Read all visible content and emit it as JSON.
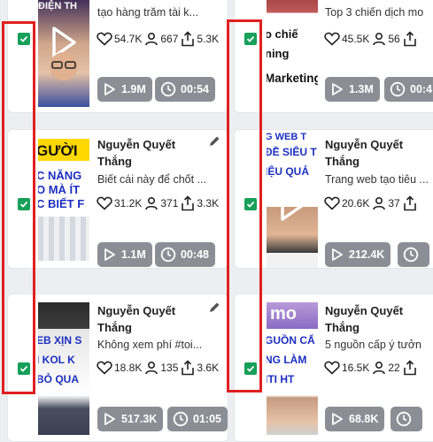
{
  "cards": [
    {
      "author_line1": "",
      "author_line2": "",
      "desc": "tạo hàng trăm tài k...",
      "likes": "54.7K",
      "users": "667",
      "shares": "5.3K",
      "views": "1.9M",
      "duration": "00:54",
      "thumb_text": [
        "ĐIỆN TH"
      ]
    },
    {
      "author_line1": "",
      "author_line2": "",
      "desc": "Top 3 chiến dịch mo",
      "likes": "45.5K",
      "users": "56",
      "shares": "",
      "views": "1.3M",
      "duration": "00:4",
      "thumb_text": [
        "o chiế",
        "ning",
        "Marketing"
      ]
    },
    {
      "author_line1": "Nguyễn Quyết",
      "author_line2": "Thắng",
      "desc": "Biết cái này để chốt ...",
      "likes": "31.2K",
      "users": "371",
      "shares": "3.3K",
      "views": "1.1M",
      "duration": "00:48",
      "thumb_text": [
        "GƯỜI",
        "C NĂNG",
        "O MÀ ÍT",
        "C BIẾT F"
      ]
    },
    {
      "author_line1": "Nguyễn Quyết",
      "author_line2": "Thắng",
      "desc": "Trang web tạo tiêu ...",
      "likes": "20.6K",
      "users": "37",
      "shares": "",
      "views": "212.4K",
      "duration": "",
      "thumb_text": [
        "G WEB T",
        "ĐỀ SIÊU T",
        "IỆU QUẢ"
      ]
    },
    {
      "author_line1": "Nguyễn Quyết",
      "author_line2": "Thắng",
      "desc": "Không xem phí #toi...",
      "likes": "18.8K",
      "users": "135",
      "shares": "3.6K",
      "views": "517.3K",
      "duration": "01:05",
      "thumb_text": [
        "EB XỊN S",
        "I KOL K",
        "BỎ QUA"
      ]
    },
    {
      "author_line1": "Nguyễn Quyết",
      "author_line2": "Thắng",
      "desc": "5 nguồn cấp ý tưởn",
      "likes": "16.5K",
      "users": "22",
      "shares": "",
      "views": "68.8K",
      "duration": "",
      "thumb_text": [
        "mo",
        "GUỒN CẤ",
        "NG LÀM",
        "ITI HT"
      ]
    }
  ],
  "colors": {
    "check": "#16a05a",
    "pill": "#8b8f95",
    "highlight": "#e02020"
  },
  "icons": [
    "checkbox-checked-icon",
    "heart-icon",
    "user-icon",
    "share-icon",
    "play-icon",
    "clock-icon",
    "pencil-icon"
  ]
}
